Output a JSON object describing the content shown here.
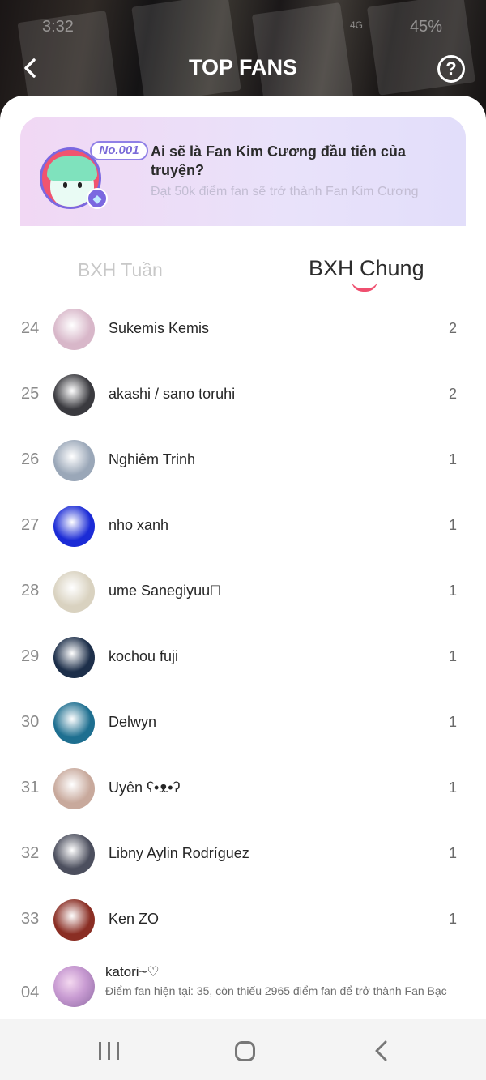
{
  "status_bar": {
    "time": "3:32",
    "network": "4G",
    "battery": "45%"
  },
  "header": {
    "title": "TOP FANS",
    "back_icon": "chevron-left-icon",
    "help_icon": "question-circle-icon",
    "help_label": "?"
  },
  "promo": {
    "rank_label": "No.001",
    "title": "Ai sẽ là Fan Kim Cương đầu tiên của truyện?",
    "subtitle": "Đạt 50k điểm fan sẽ trở thành Fan Kim Cương",
    "badge_icon": "diamond-icon"
  },
  "tabs": [
    {
      "label": "BXH Tuần",
      "active": false
    },
    {
      "label": "BXH Chung",
      "active": true
    }
  ],
  "fans": [
    {
      "rank": "24",
      "name": "Sukemis Kemis",
      "score": "2",
      "avatar_color": "#d8b7c9"
    },
    {
      "rank": "25",
      "name": "akashi / sano toruhi",
      "score": "2",
      "avatar_color": "#3a3a3f"
    },
    {
      "rank": "26",
      "name": "Nghiêm Trinh",
      "score": "1",
      "avatar_color": "#9aa7b8"
    },
    {
      "rank": "27",
      "name": "nho xanh",
      "score": "1",
      "avatar_color": "#1b2bd6"
    },
    {
      "rank": "28",
      "name": "ume Sanegiyuu🏻",
      "score": "1",
      "avatar_color": "#d9d2c0"
    },
    {
      "rank": "29",
      "name": "kochou fuji",
      "score": "1",
      "avatar_color": "#1d2f4a"
    },
    {
      "rank": "30",
      "name": "Delwyn",
      "score": "1",
      "avatar_color": "#1e6f90"
    },
    {
      "rank": "31",
      "name": "Uyên ʕ•ᴥ•ʔ",
      "score": "1",
      "avatar_color": "#c8a99c"
    },
    {
      "rank": "32",
      "name": "Libny Aylin Rodríguez",
      "score": "1",
      "avatar_color": "#4c4f5e"
    },
    {
      "rank": "33",
      "name": "Ken ZO",
      "score": "1",
      "avatar_color": "#8a2e24"
    }
  ],
  "current_user": {
    "rank": "04",
    "name": "katori~♡",
    "note": "Điểm fan hiện tại: 35, còn thiếu 2965 điểm fan để trở thành Fan Bạc"
  },
  "nav": {
    "recent_icon": "recent-apps-icon",
    "home_icon": "home-icon",
    "back_icon": "back-icon"
  },
  "colors": {
    "accent": "#ef4f6f",
    "promo_bg": "#ece0f8",
    "badge": "#7b68e0"
  }
}
